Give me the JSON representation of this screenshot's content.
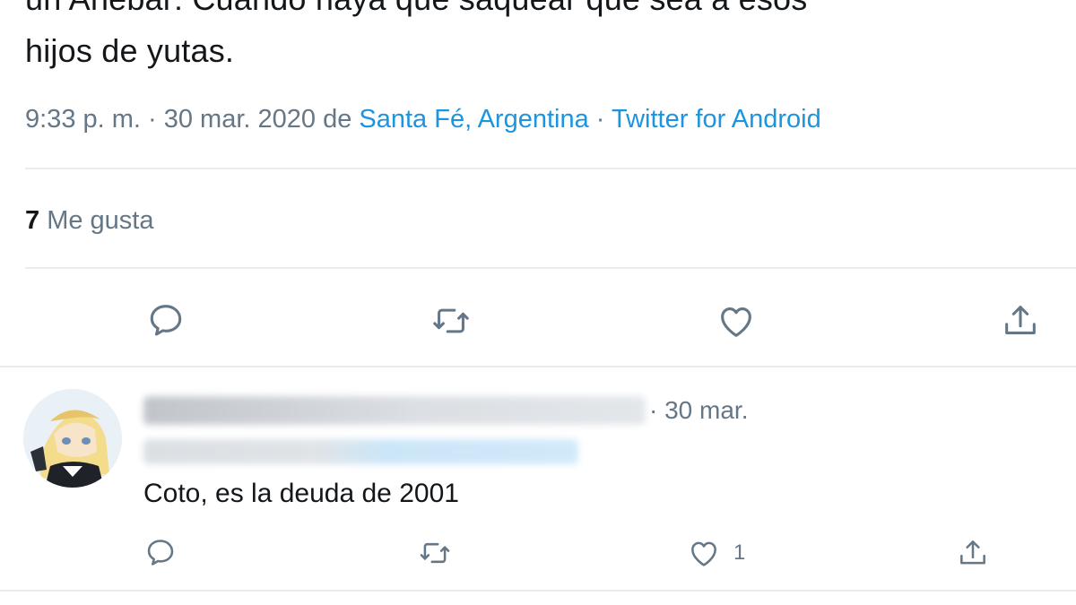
{
  "tweet": {
    "text_cut_top": "un Añebar: Cuando haya que saquear que sea a esos",
    "text_line": "hijos de yutas.",
    "time": "9:33 p. m. · 30 mar. 2020 de ",
    "location": "Santa Fé, Argentina",
    "sep": " · ",
    "source": "Twitter for Android",
    "likes_count": "7",
    "likes_label": " Me gusta"
  },
  "actions": {
    "reply_icon": "comment-icon",
    "retweet_icon": "retweet-icon",
    "like_icon": "heart-icon",
    "share_icon": "share-icon"
  },
  "reply": {
    "date": "· 30 mar.",
    "text": "Coto, es la deuda de 2001",
    "like_count": "1"
  },
  "colors": {
    "link": "#1b95e0",
    "muted": "#657786",
    "icon": "#657786",
    "divider": "#e6ecf0"
  }
}
